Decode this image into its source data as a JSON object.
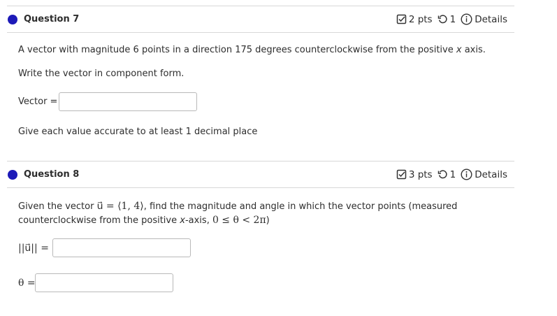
{
  "q7": {
    "title": "Question 7",
    "points": "2 pts",
    "attempts": "1",
    "details": "Details",
    "prompt_pre": "A vector with magnitude 6 points in a direction 175 degrees counterclockwise from the positive ",
    "prompt_var": "x",
    "prompt_post": " axis.",
    "instruction": "Write the vector in component form.",
    "vector_label": "Vector =",
    "vector_value": "",
    "hint": "Give each value accurate to at least 1 decimal place"
  },
  "q8": {
    "title": "Question 8",
    "points": "3 pts",
    "attempts": "1",
    "details": "Details",
    "prompt_a": "Given the vector ",
    "vector_expr": "u⃗ = ⟨1, 4⟩",
    "prompt_b": ", find the magnitude and angle in which the vector points (measured",
    "prompt_c": "counterclockwise from the positive ",
    "prompt_var": "x",
    "prompt_d": "-axis, ",
    "range_expr": "0 ≤ θ < 2π",
    "prompt_e": ")",
    "magnitude_label": "||u⃗|| =",
    "magnitude_value": "",
    "theta_label": "θ =",
    "theta_value": ""
  },
  "colors": {
    "accent": "#1d1ab8",
    "rule": "#d8d8d8",
    "input_border": "#b9b9b9"
  }
}
